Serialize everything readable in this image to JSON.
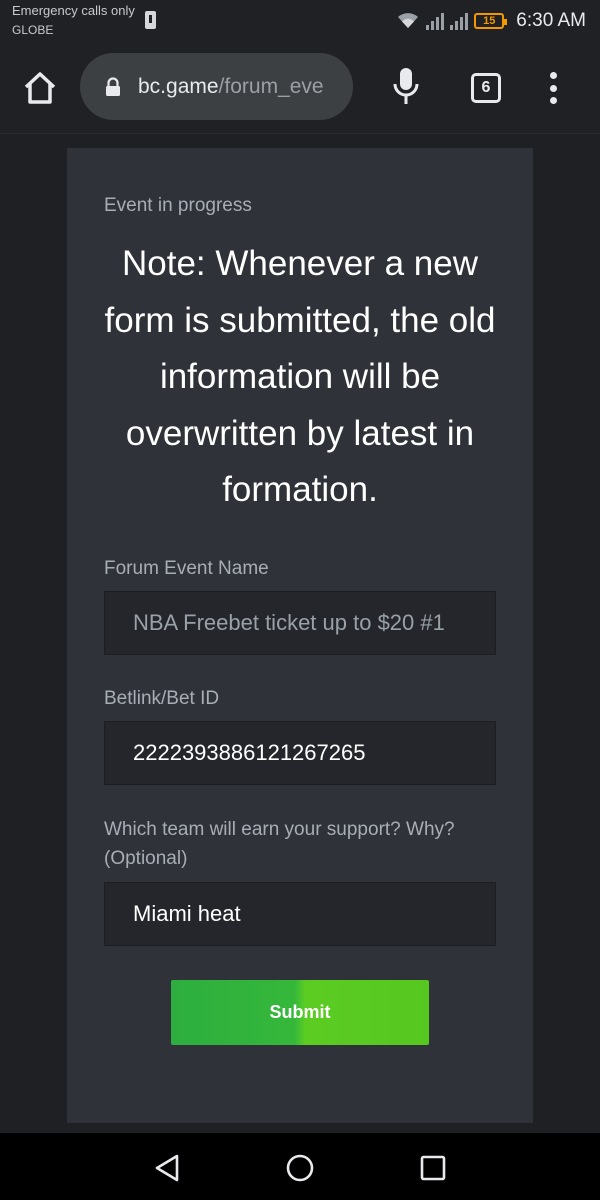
{
  "status_bar": {
    "carrier_line1": "Emergency calls only",
    "carrier_line2": "GLOBE",
    "battery_level": "15",
    "time": "6:30 AM"
  },
  "browser": {
    "url_domain": "bc.game",
    "url_path": "/forum_eve",
    "tab_count": "6"
  },
  "form": {
    "status": "Event in progress",
    "note": "Note: Whenever a new form is submitted, the old information will be overwritten by latest in formation.",
    "fields": [
      {
        "label": "Forum Event Name",
        "value": "NBA Freebet ticket up to $20 #1",
        "disabled": true
      },
      {
        "label": "Betlink/Bet ID",
        "value": "2222393886121267265"
      },
      {
        "label": "Which team will earn your support? Why?\n(Optional)",
        "value": "Miami heat"
      }
    ],
    "submit_label": "Submit"
  },
  "colors": {
    "accent_green": "#3ebf32",
    "card_bg": "#2f3238",
    "input_bg": "#24262b",
    "battery": "#f29900"
  },
  "icons": [
    "sim-icon",
    "wifi-icon",
    "signal-icon",
    "battery-icon",
    "home-icon",
    "lock-icon",
    "mic-icon",
    "tabs-icon",
    "more-vert-icon",
    "back-icon",
    "home-circle-icon",
    "recents-icon"
  ]
}
